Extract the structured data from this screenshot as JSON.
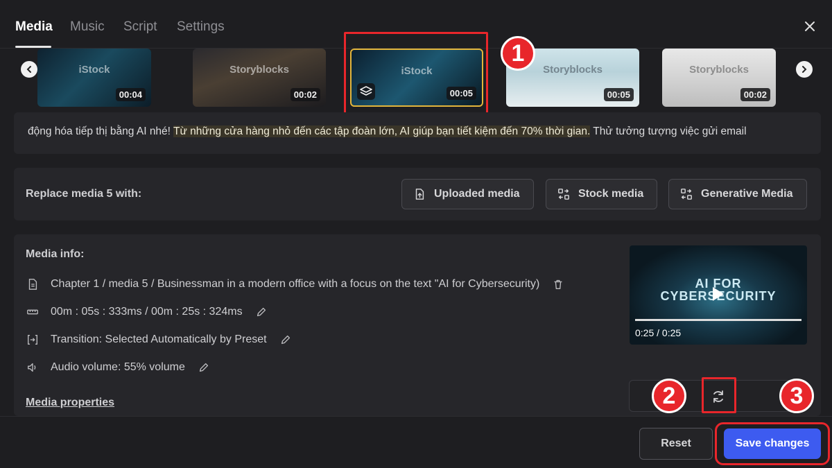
{
  "tabs": [
    {
      "label": "Media",
      "active": true
    },
    {
      "label": "Music",
      "active": false
    },
    {
      "label": "Script",
      "active": false
    },
    {
      "label": "Settings",
      "active": false
    }
  ],
  "thumbnails": [
    {
      "watermark": "iStock",
      "duration": "00:04"
    },
    {
      "watermark": "Storyblocks",
      "duration": "00:02"
    },
    {
      "watermark": "iStock",
      "duration": "00:05",
      "selected": true
    },
    {
      "watermark": "Storyblocks",
      "duration": "00:05"
    },
    {
      "watermark": "Storyblocks",
      "duration": "00:02"
    }
  ],
  "script": {
    "before": "động hóa tiếp thị bằng AI nhé! ",
    "highlight": "Từ những cửa hàng nhỏ đến các tập đoàn lớn, AI giúp bạn tiết kiệm đến 70% thời gian.",
    "after": " Thử tưởng tượng việc gửi email"
  },
  "replace": {
    "label": "Replace media 5 with:",
    "buttons": {
      "uploaded": "Uploaded media",
      "stock": "Stock media",
      "generative": "Generative Media"
    }
  },
  "media_info": {
    "title": "Media info:",
    "path": "Chapter 1 / media 5 / Businessman in a modern office with a focus on the text \"AI for Cybersecurity)",
    "timing": "00m : 05s : 333ms / 00m : 25s : 324ms",
    "transition": "Transition: Selected Automatically by Preset",
    "audio": "Audio volume: 55% volume",
    "properties_link": "Media properties"
  },
  "preview": {
    "overlay_line1": "AI FOR",
    "overlay_line2": "CYBERSECURITY",
    "time": "0:25 / 0:25"
  },
  "annotations": {
    "one": "1",
    "two": "2",
    "three": "3"
  },
  "footer": {
    "reset": "Reset",
    "save": "Save changes"
  },
  "colors": {
    "accent": "#3d5bf0",
    "annotation": "#e8262b",
    "selected_border": "#e3b53b"
  }
}
